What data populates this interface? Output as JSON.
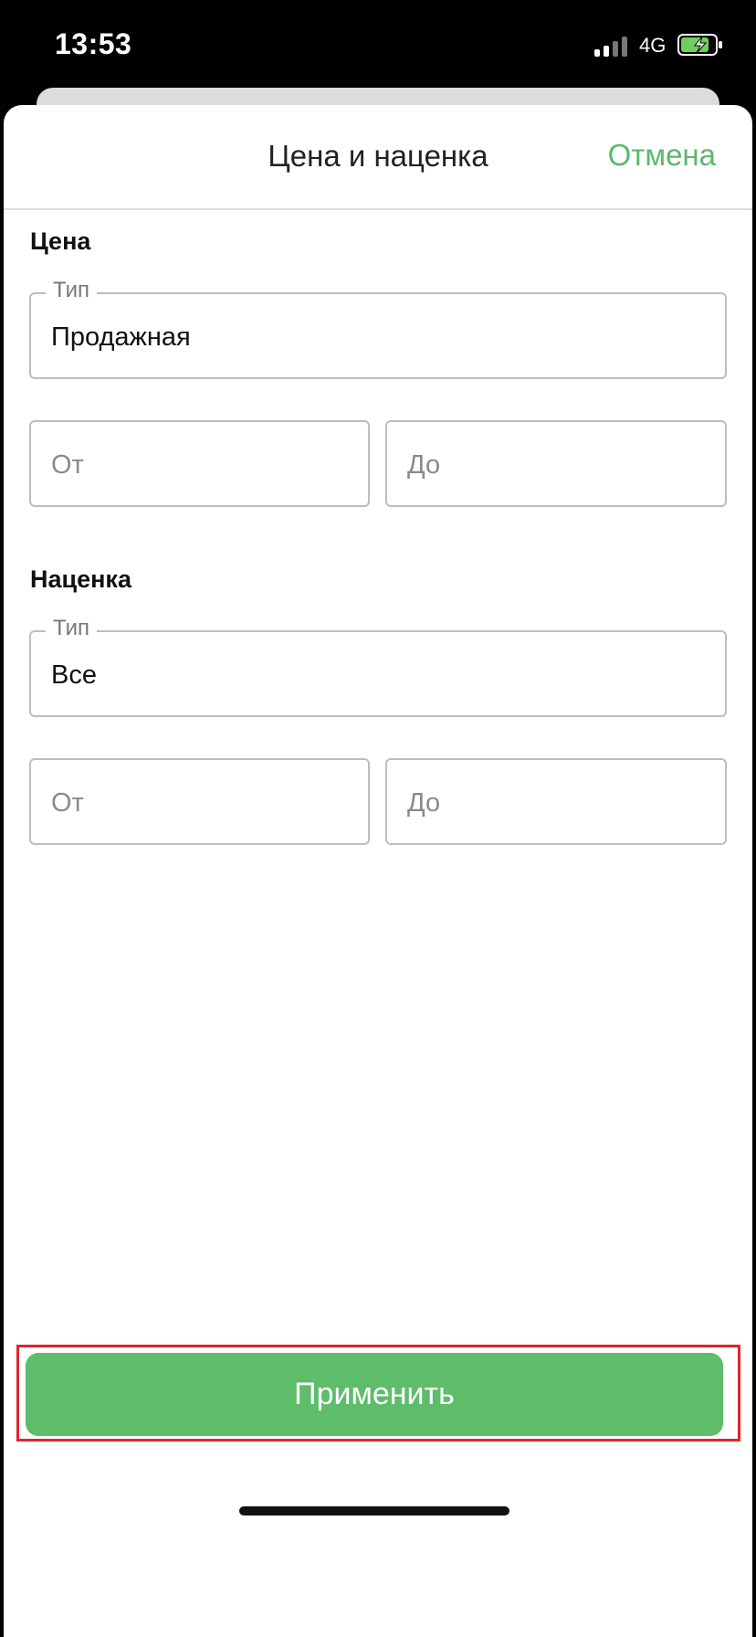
{
  "status_bar": {
    "time": "13:53",
    "network": "4G",
    "battery_color": "#6fcf5a"
  },
  "sheet": {
    "title": "Цена и наценка",
    "cancel_label": "Отмена",
    "accent_color": "#5ebd6b"
  },
  "price": {
    "section_title": "Цена",
    "type_label": "Тип",
    "type_value": "Продажная",
    "from_placeholder": "От",
    "to_placeholder": "До"
  },
  "markup": {
    "section_title": "Наценка",
    "type_label": "Тип",
    "type_value": "Все",
    "from_placeholder": "От",
    "to_placeholder": "До"
  },
  "apply_label": "Применить"
}
